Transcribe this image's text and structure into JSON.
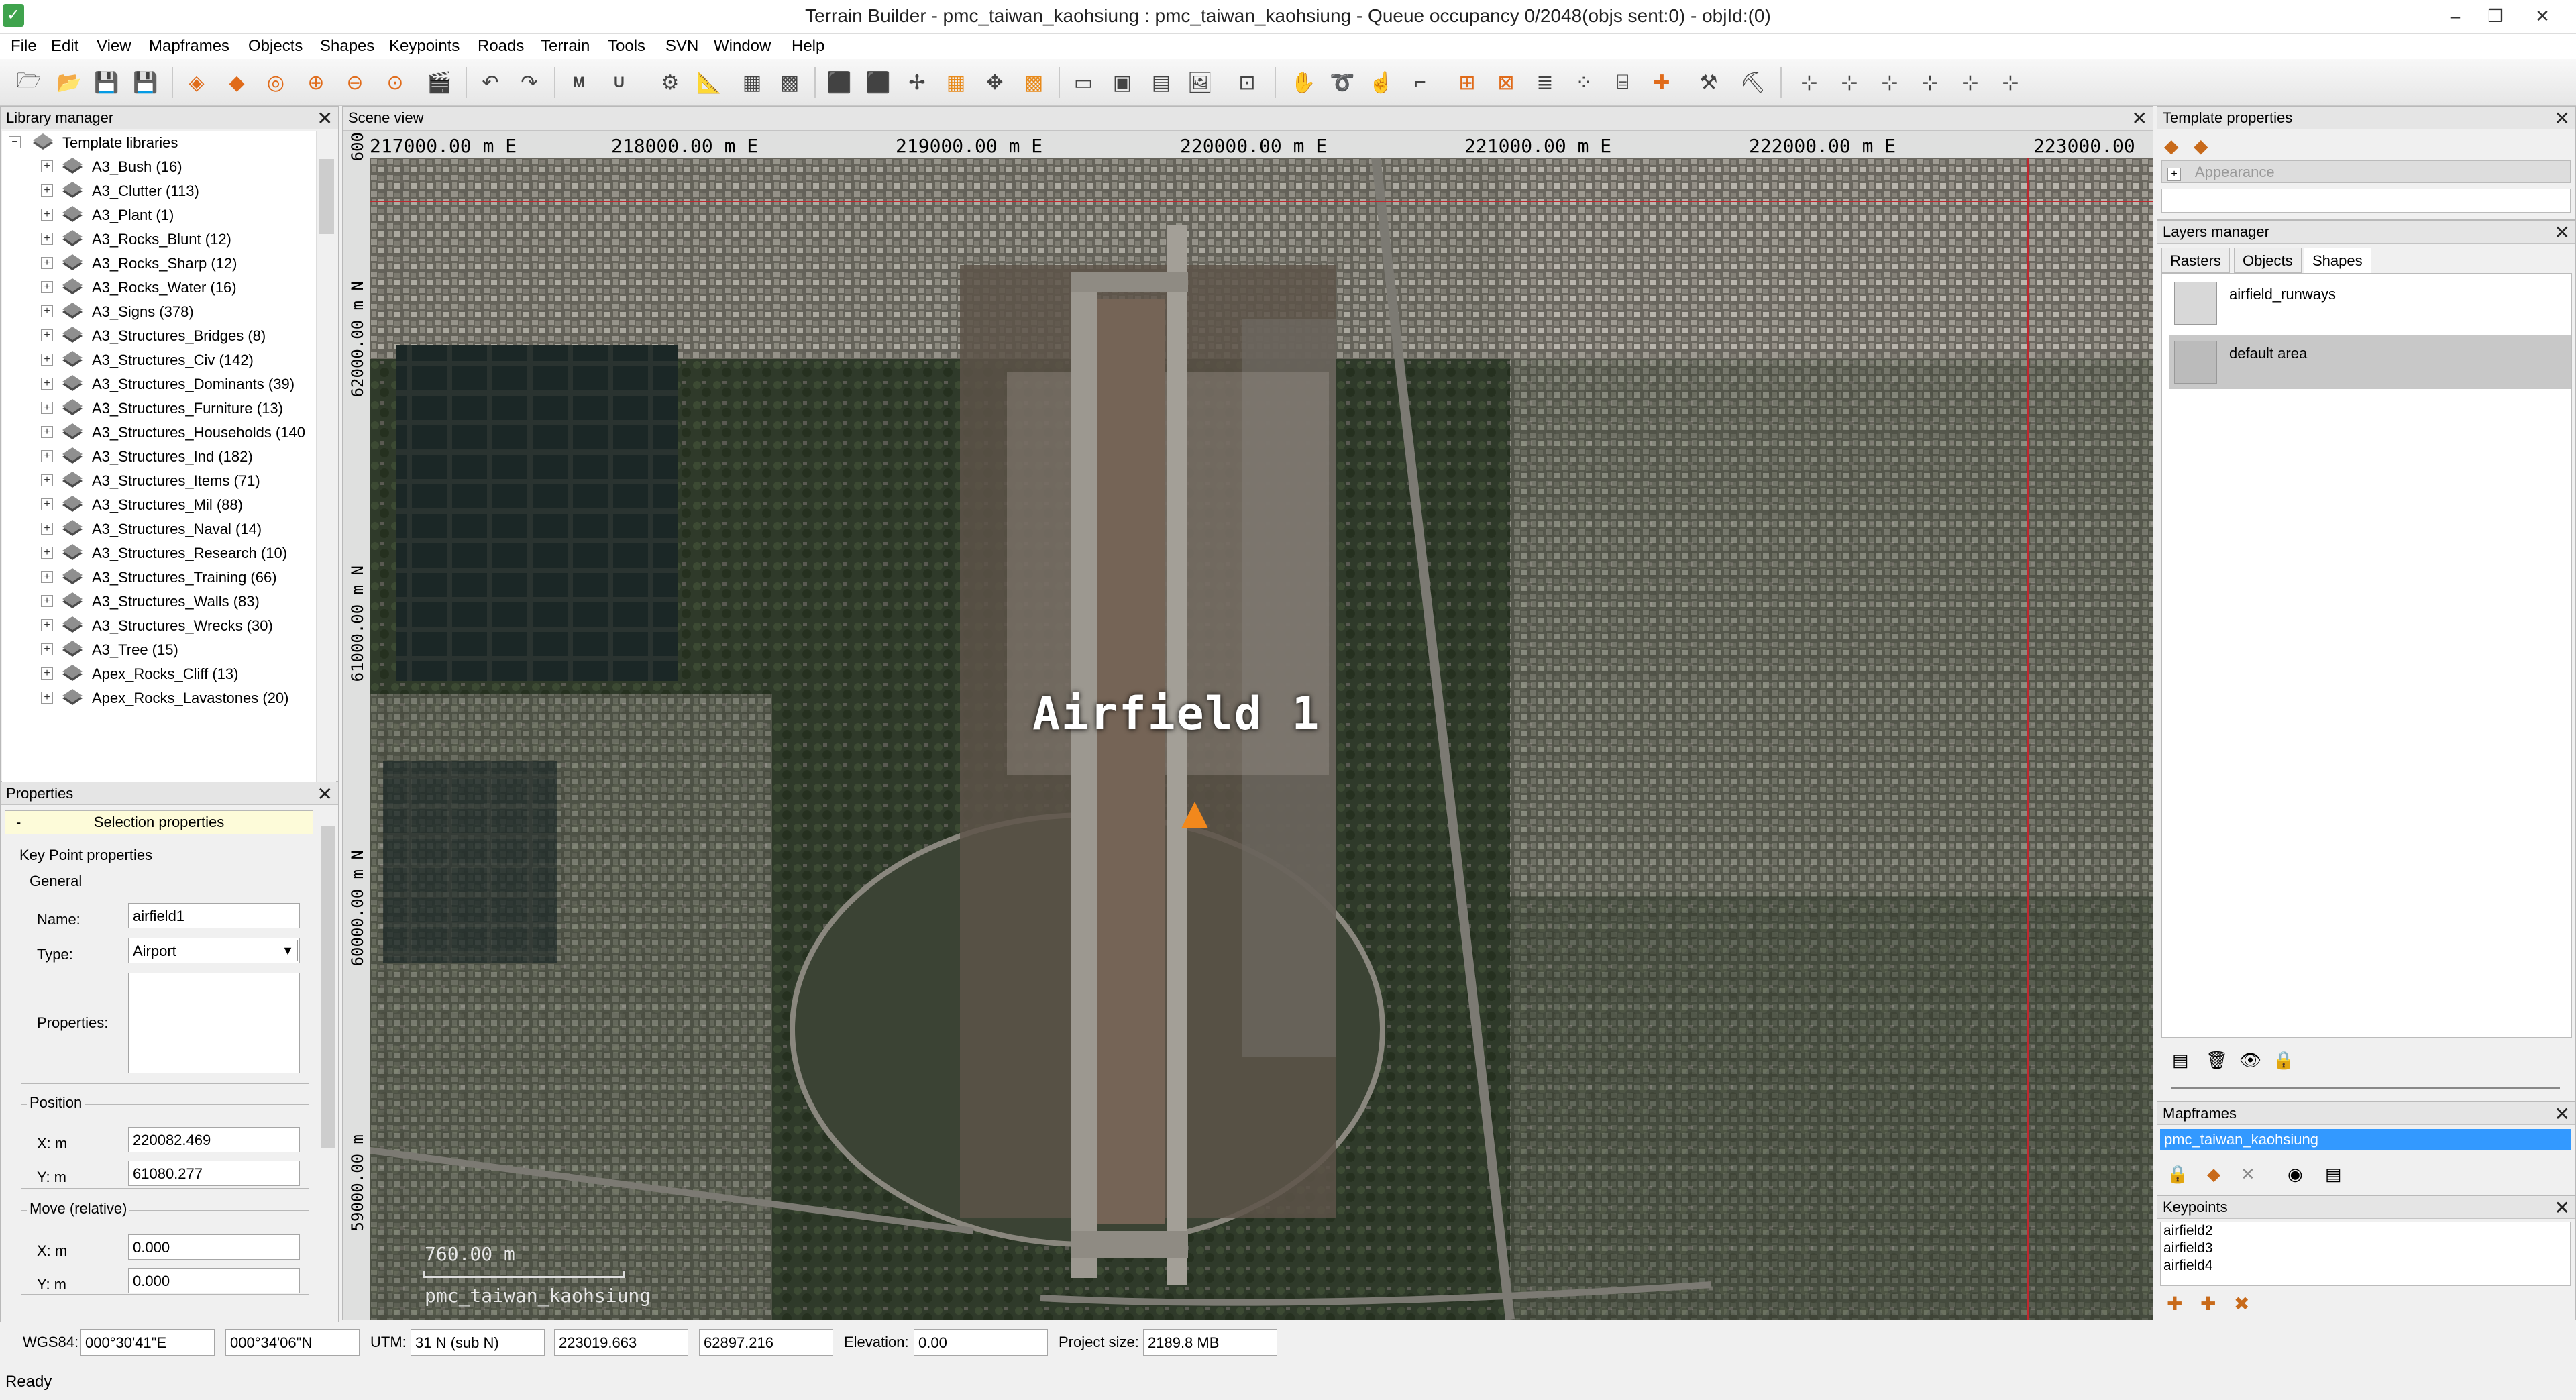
{
  "window": {
    "title": "Terrain Builder - pmc_taiwan_kaohsiung : pmc_taiwan_kaohsiung - Queue occupancy 0/2048(objs sent:0) - objId:(0)",
    "minimize": "–",
    "restore": "❐",
    "close": "✕"
  },
  "menu": [
    "File",
    "Edit",
    "View",
    "Mapframes",
    "Objects",
    "Shapes",
    "Keypoints",
    "Roads",
    "Terrain",
    "Tools",
    "SVN",
    "Window",
    "Help"
  ],
  "library_manager": {
    "title": "Library manager",
    "root_label": "Template libraries",
    "items": [
      "A3_Bush (16)",
      "A3_Clutter (113)",
      "A3_Plant (1)",
      "A3_Rocks_Blunt (12)",
      "A3_Rocks_Sharp (12)",
      "A3_Rocks_Water (16)",
      "A3_Signs (378)",
      "A3_Structures_Bridges (8)",
      "A3_Structures_Civ (142)",
      "A3_Structures_Dominants (39)",
      "A3_Structures_Furniture (13)",
      "A3_Structures_Households (140",
      "A3_Structures_Ind (182)",
      "A3_Structures_Items (71)",
      "A3_Structures_Mil (88)",
      "A3_Structures_Naval (14)",
      "A3_Structures_Research (10)",
      "A3_Structures_Training (66)",
      "A3_Structures_Walls (83)",
      "A3_Structures_Wrecks (30)",
      "A3_Tree (15)",
      "Apex_Rocks_Cliff (13)",
      "Apex_Rocks_Lavastones (20)"
    ]
  },
  "properties": {
    "title": "Properties",
    "selection_header": "Selection properties",
    "collapse": "-",
    "group_title": "Key Point properties",
    "general_label": "General",
    "name_label": "Name:",
    "name_value": "airfield1",
    "type_label": "Type:",
    "type_value": "Airport",
    "properties_label": "Properties:",
    "position_label": "Position",
    "x_label": "X: m",
    "x_value": "220082.469",
    "y_label": "Y: m",
    "y_value": "61080.277",
    "move_label": "Move (relative)",
    "move_x_label": "X: m",
    "move_x_value": "0.000",
    "move_y_label": "Y: m",
    "move_y_value": "0.000"
  },
  "scene": {
    "title": "Scene view",
    "x_ticks": [
      "217000.00 m E",
      "218000.00 m E",
      "219000.00 m E",
      "220000.00 m E",
      "221000.00 m E",
      "222000.00 m E",
      "223000.00"
    ],
    "y_ticks": [
      "62000.00 m N",
      "61000.00 m N",
      "60000.00 m N",
      "59000.00 m"
    ],
    "y_tick_top": "600",
    "airfield_label": "Airfield 1",
    "scale_label": "760.00 m",
    "map_name": "pmc_taiwan_kaohsiung"
  },
  "template_properties": {
    "title": "Template properties",
    "appearance": "Appearance"
  },
  "layers_manager": {
    "title": "Layers manager",
    "tabs": [
      "Rasters",
      "Objects",
      "Shapes"
    ],
    "active_tab": "Shapes",
    "layers": [
      "airfield_runways",
      "default area"
    ]
  },
  "mapframes": {
    "title": "Mapframes",
    "items": [
      "pmc_taiwan_kaohsiung"
    ]
  },
  "keypoints": {
    "title": "Keypoints",
    "items": [
      "airfield2",
      "airfield3",
      "airfield4"
    ]
  },
  "statusbar": {
    "wgs84_label": "WGS84:",
    "wgs84_lon": "000°30'41\"E",
    "wgs84_lat": "000°34'06\"N",
    "utm_label": "UTM:",
    "utm_zone": "31 N (sub N)",
    "utm_x": "223019.663",
    "utm_y": "62897.216",
    "elevation_label": "Elevation:",
    "elevation_value": "0.00",
    "project_size_label": "Project size:",
    "project_size_value": "2189.8 MB",
    "ready": "Ready"
  }
}
